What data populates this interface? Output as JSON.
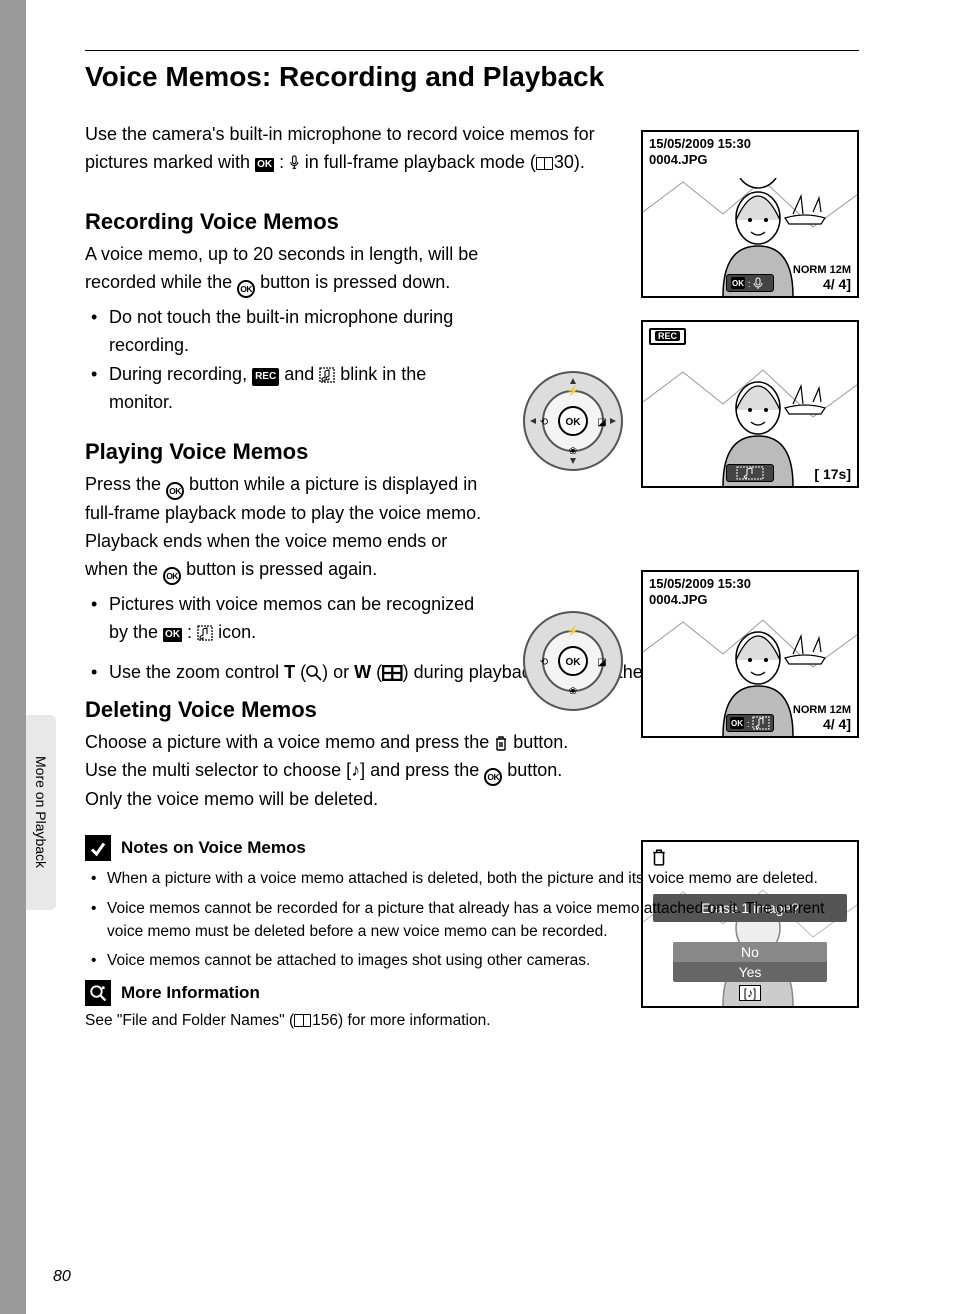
{
  "sideTab": "More on Playback",
  "pageNumber": "80",
  "title": "Voice Memos: Recording and Playback",
  "intro": {
    "part1": "Use the camera's built-in microphone to record voice memos for pictures marked with ",
    "part2": " in full-frame playback mode (",
    "pageRef": "30",
    "part3": ")."
  },
  "sections": {
    "recording": {
      "heading": "Recording Voice Memos",
      "body1": "A voice memo, up to 20 seconds in length, will be recorded while the ",
      "body2": " button is pressed down.",
      "bullets": [
        "Do not touch the built-in microphone during recording.",
        "During recording, __REC__ and __MEMO__ blink in the monitor."
      ]
    },
    "playing": {
      "heading": "Playing Voice Memos",
      "body1": "Press the ",
      "body2": " button while a picture is displayed in full-frame playback mode to play the voice memo. Playback ends when the voice memo ends or when the ",
      "body3": " button is pressed again.",
      "bullet1a": "Pictures with voice memos can be recognized by the ",
      "bullet1b": " icon.",
      "bullet2a": "Use the zoom control ",
      "bullet2b": " or ",
      "bullet2c": " during playback to adjust the volume."
    },
    "deleting": {
      "heading": "Deleting Voice Memos",
      "body1": "Choose a picture with a voice memo and press the ",
      "body2": " button. Use the multi selector to choose ",
      "body3": " and press the ",
      "body4": " button. Only the voice memo will be deleted."
    }
  },
  "notes": {
    "heading": "Notes on Voice Memos",
    "items": [
      "When a picture with a voice memo attached is deleted, both the picture and its voice memo are deleted.",
      "Voice memos cannot be recorded for a picture that already has a voice memo attached on it. The current voice memo must be deleted before a new voice memo can be recorded.",
      "Voice memos cannot be attached to images shot using other cameras."
    ]
  },
  "moreInfo": {
    "heading": "More Information",
    "text1": "See \"File and Folder Names\" (",
    "pageRef": "156",
    "text2": ") for more information."
  },
  "lcd": {
    "datetime": "15/05/2009 15:30",
    "filename": "0004.JPG",
    "quality": "NORM",
    "size": "12M",
    "counter": "4/    4]",
    "recTimer": "[  17s]",
    "recLabel": "REC",
    "okLabel": "OK"
  },
  "erase": {
    "prompt": "Erase 1 image?",
    "optNo": "No",
    "optYes": "Yes"
  },
  "glyphs": {
    "T": "T",
    "W": "W"
  }
}
